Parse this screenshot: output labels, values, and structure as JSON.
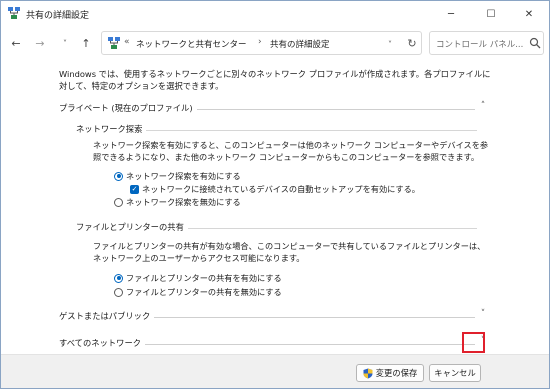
{
  "window": {
    "title": "共有の詳細設定",
    "controls": {
      "minimize": "─",
      "maximize": "☐",
      "close": "✕"
    }
  },
  "nav": {
    "back": "←",
    "forward": "→",
    "recent": "˅",
    "up": "↑",
    "address": {
      "overflow": "«",
      "separator": "›",
      "crumbs": [
        "ネットワークと共有センター",
        "共有の詳細設定"
      ],
      "dropdown": "˅",
      "refresh": "↻"
    },
    "search": {
      "placeholder": "コントロール パネル..."
    }
  },
  "content": {
    "intro": "Windows では、使用するネットワークごとに別々のネットワーク プロファイルが作成されます。各プロファイルに対して、特定のオプションを選択できます。",
    "private": {
      "heading": "プライベート (現在のプロファイル)",
      "chevron": "˄",
      "discovery": {
        "heading": "ネットワーク探索",
        "desc": "ネットワーク探索を有効にすると、このコンピューターは他のネットワーク コンピューターやデバイスを参照できるようになり、また他のネットワーク コンピューターからもこのコンピューターを参照できます。",
        "on_label": "ネットワーク探索を有効にする",
        "auto_setup_label": "ネットワークに接続されているデバイスの自動セットアップを有効にする。",
        "off_label": "ネットワーク探索を無効にする",
        "selected": "on",
        "auto_setup_checked": true
      },
      "file_sharing": {
        "heading": "ファイルとプリンターの共有",
        "desc": "ファイルとプリンターの共有が有効な場合、このコンピューターで共有しているファイルとプリンターは、ネットワーク上のユーザーからアクセス可能になります。",
        "on_label": "ファイルとプリンターの共有を有効にする",
        "off_label": "ファイルとプリンターの共有を無効にする",
        "selected": "on"
      }
    },
    "guest": {
      "heading": "ゲストまたはパブリック",
      "chevron": "˅"
    },
    "all": {
      "heading": "すべてのネットワーク",
      "chevron": "˅"
    }
  },
  "footer": {
    "save_label": "変更の保存",
    "cancel_label": "キャンセル"
  },
  "colors": {
    "accent": "#0067c0",
    "highlight_box": "#e0202c"
  }
}
